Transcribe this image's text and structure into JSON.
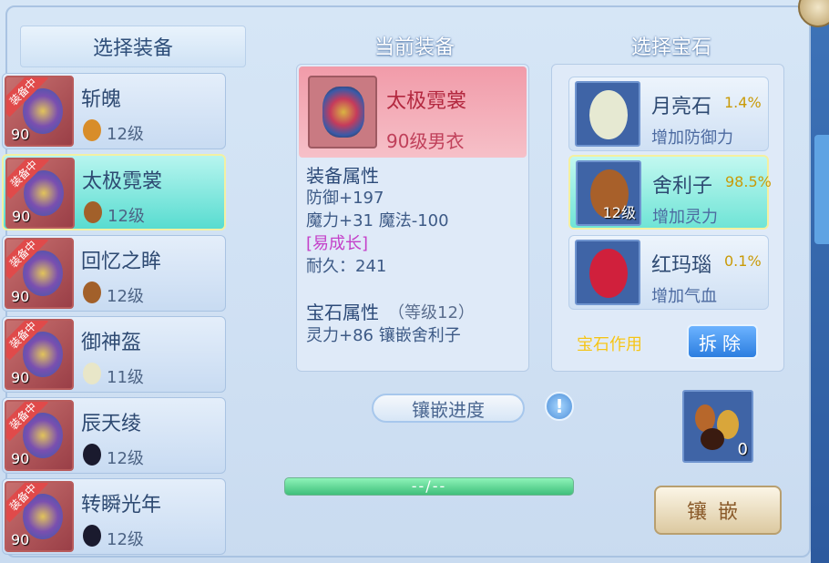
{
  "left_panel": {
    "title": "选择装备",
    "items": [
      {
        "name": "斩魄",
        "level": "90",
        "badge": "装备中",
        "gem_level": "12级",
        "gem_color": "#d88d2a"
      },
      {
        "name": "太极霓裳",
        "level": "90",
        "badge": "装备中",
        "gem_level": "12级",
        "gem_color": "#a2602a",
        "selected": true
      },
      {
        "name": "回忆之眸",
        "level": "90",
        "badge": "装备中",
        "gem_level": "12级",
        "gem_color": "#a2602a"
      },
      {
        "name": "御神盔",
        "level": "90",
        "badge": "装备中",
        "gem_level": "11级",
        "gem_color": "#e8e6c8"
      },
      {
        "name": "辰天绫",
        "level": "90",
        "badge": "装备中",
        "gem_level": "12级",
        "gem_color": "#1a1a2e"
      },
      {
        "name": "转瞬光年",
        "level": "90",
        "badge": "装备中",
        "gem_level": "12级",
        "gem_color": "#1a1a2e"
      }
    ]
  },
  "middle_panel": {
    "title": "当前装备",
    "item_name": "太极霓裳",
    "item_subtitle": "90级男衣",
    "attributes_heading": "装备属性",
    "attributes": [
      "防御+197",
      "魔力+31 魔法-100"
    ],
    "special_tag": "[易成长]",
    "durability": "耐久：241",
    "gem_attr_heading": "宝石属性",
    "gem_attr_level": "（等级12）",
    "gem_attr_value": "灵力+86 镶嵌舍利子",
    "progress_label": "镶嵌进度",
    "progress_text": "--/--"
  },
  "right_panel": {
    "title": "选择宝石",
    "gems": [
      {
        "name": "月亮石",
        "percent": "1.4%",
        "effect": "增加防御力",
        "color": "#e6e9d2",
        "count": ""
      },
      {
        "name": "舍利子",
        "percent": "98.5%",
        "effect": "增加灵力",
        "color": "#a8602a",
        "count": "12级",
        "selected": true
      },
      {
        "name": "红玛瑙",
        "percent": "0.1%",
        "effect": "增加气血",
        "color": "#d0203c",
        "count": ""
      }
    ],
    "gem_use_label": "宝石作用",
    "remove_label": "拆除",
    "slot_count": "0",
    "inlay_label": "镶嵌"
  },
  "colors": {
    "accent": "#2c7ee0",
    "progress": "#3fbf7b",
    "highlight": "#58dcd0"
  }
}
